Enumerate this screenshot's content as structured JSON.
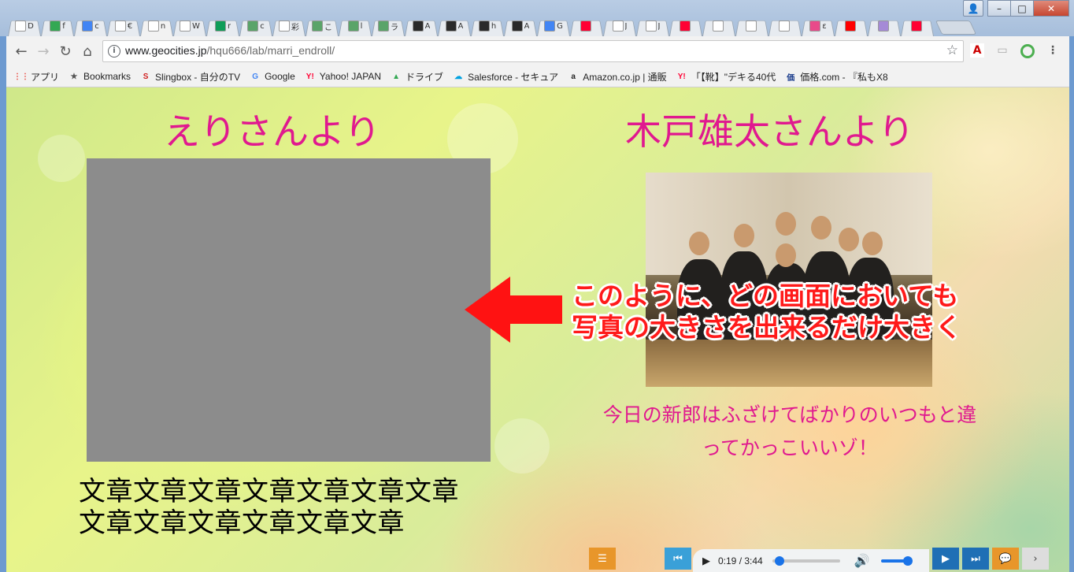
{
  "browser": {
    "tabs": [
      {
        "label": "D",
        "icon": "doc-icon",
        "color": "#ffffff"
      },
      {
        "label": "f",
        "icon": "drive-icon",
        "color": "#34a853"
      },
      {
        "label": "c",
        "icon": "docs-icon",
        "color": "#4285f4"
      },
      {
        "label": "€",
        "icon": "doc-icon",
        "color": "#ffffff"
      },
      {
        "label": "n",
        "icon": "close-icon",
        "color": "#ffffff",
        "active": true
      },
      {
        "label": "W",
        "icon": "wikipedia-icon",
        "color": "#ffffff"
      },
      {
        "label": "r",
        "icon": "sheets-icon",
        "color": "#0f9d58"
      },
      {
        "label": "c",
        "icon": "gear-icon",
        "color": "#5aa469"
      },
      {
        "label": "彩",
        "icon": "logo-icon",
        "color": "#ffffff"
      },
      {
        "label": "こ",
        "icon": "gear-icon",
        "color": "#5aa469"
      },
      {
        "label": "l",
        "icon": "gear-icon",
        "color": "#5aa469"
      },
      {
        "label": "ラ",
        "icon": "gear-icon",
        "color": "#5aa469"
      },
      {
        "label": "A",
        "icon": "app-icon",
        "color": "#2a2a2a"
      },
      {
        "label": "A",
        "icon": "app-icon",
        "color": "#2a2a2a"
      },
      {
        "label": "h",
        "icon": "app-icon",
        "color": "#2a2a2a"
      },
      {
        "label": "A",
        "icon": "app-icon",
        "color": "#2a2a2a"
      },
      {
        "label": "G",
        "icon": "translate-icon",
        "color": "#4285f4"
      },
      {
        "label": "",
        "icon": "yahoo-icon",
        "color": "#ff0033"
      },
      {
        "label": "J",
        "icon": "doc-icon",
        "color": "#ffffff"
      },
      {
        "label": "J",
        "icon": "doc-icon",
        "color": "#ffffff"
      },
      {
        "label": "",
        "icon": "yahoo-icon",
        "color": "#ff0033"
      },
      {
        "label": "",
        "icon": "doc-icon",
        "color": "#ffffff"
      },
      {
        "label": "",
        "icon": "doc-icon",
        "color": "#ffffff"
      },
      {
        "label": "",
        "icon": "doc-icon",
        "color": "#ffffff"
      },
      {
        "label": "ε",
        "icon": "smile-icon",
        "color": "#e84a8a"
      },
      {
        "label": "",
        "icon": "youtube-icon",
        "color": "#ff0000"
      },
      {
        "label": "",
        "icon": "flower-icon",
        "color": "#a58ad6"
      },
      {
        "label": "",
        "icon": "yahoo-icon",
        "color": "#ff0033"
      }
    ],
    "url_host": "www.geocities.jp",
    "url_path": "/hqu666/lab/marri_endroll/",
    "bookmarks": [
      {
        "label": "アプリ",
        "icon": "apps-grid-icon"
      },
      {
        "label": "Bookmarks",
        "icon": "star-icon"
      },
      {
        "label": "Slingbox - 自分のTV",
        "icon": "slingbox-icon"
      },
      {
        "label": "Google",
        "icon": "google-icon"
      },
      {
        "label": "Yahoo! JAPAN",
        "icon": "yahoo-icon"
      },
      {
        "label": "ドライブ",
        "icon": "drive-icon"
      },
      {
        "label": "Salesforce - セキュア",
        "icon": "salesforce-icon"
      },
      {
        "label": "Amazon.co.jp | 通販",
        "icon": "amazon-icon"
      },
      {
        "label": "「【靴】\"デキる40代",
        "icon": "yahoo-icon"
      },
      {
        "label": "価格.com - 『私もX8",
        "icon": "kakaku-icon"
      }
    ]
  },
  "page": {
    "left_heading": "えりさんより",
    "right_heading": "木戸雄太さんより",
    "caption_line1": "今日の新郎はふざけてばかりのいつもと違",
    "caption_line2": "ってかっこいいゾ！",
    "body_line1": "文章文章文章文章文章文章文章",
    "body_line2": "文章文章文章文章文章文章",
    "annotation_line1": "このように、どの画面においても",
    "annotation_line2": "写真の大きさを出来るだけ大きく"
  },
  "player": {
    "time": "0:19 / 3:44",
    "progress": 0.085,
    "volume": 1.0
  },
  "colors": {
    "heading": "#e0198f",
    "annotation": "#ff1a1a",
    "player_blue": "#1f6fb5",
    "player_orange": "#e8962a"
  }
}
